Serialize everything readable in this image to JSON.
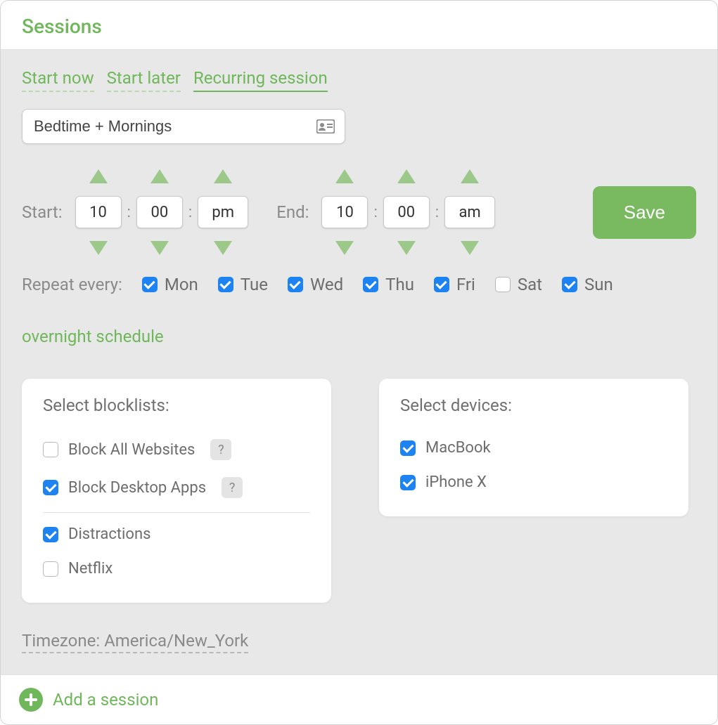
{
  "header": {
    "title": "Sessions"
  },
  "tabs": {
    "start_now": "Start now",
    "start_later": "Start later",
    "recurring": "Recurring session"
  },
  "session_name": "Bedtime + Mornings",
  "time": {
    "start_label": "Start:",
    "end_label": "End:",
    "start_hour": "10",
    "start_min": "00",
    "start_ampm": "pm",
    "end_hour": "10",
    "end_min": "00",
    "end_ampm": "am"
  },
  "save_label": "Save",
  "repeat_label": "Repeat every:",
  "days": {
    "mon": "Mon",
    "tue": "Tue",
    "wed": "Wed",
    "thu": "Thu",
    "fri": "Fri",
    "sat": "Sat",
    "sun": "Sun"
  },
  "note": "overnight schedule",
  "blocklists": {
    "title": "Select blocklists:",
    "all_websites": "Block All Websites",
    "desktop_apps": "Block Desktop Apps",
    "distractions": "Distractions",
    "netflix": "Netflix",
    "help": "?"
  },
  "devices": {
    "title": "Select devices:",
    "macbook": "MacBook",
    "iphone": "iPhone X"
  },
  "timezone_label": "Timezone: America/New_York",
  "footer": {
    "add_session": "Add a session"
  }
}
